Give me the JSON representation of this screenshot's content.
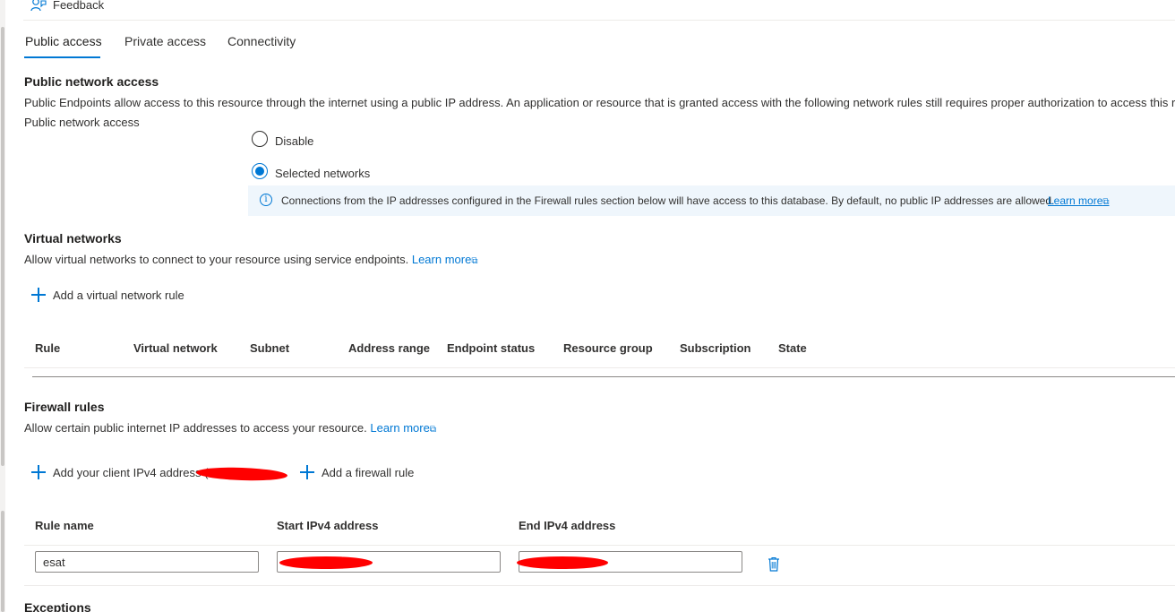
{
  "header": {
    "feedback_label": "Feedback"
  },
  "tabs": [
    {
      "label": "Public access",
      "active": true
    },
    {
      "label": "Private access",
      "active": false
    },
    {
      "label": "Connectivity",
      "active": false
    }
  ],
  "public_network_access": {
    "title": "Public network access",
    "description": "Public Endpoints allow access to this resource through the internet using a public IP address. An application or resource that is granted access with the following network rules still requires proper authorization to access this re",
    "field_label": "Public network access",
    "options": [
      {
        "label": "Disable",
        "selected": false
      },
      {
        "label": "Selected networks",
        "selected": true
      }
    ],
    "info_text": "Connections from the IP addresses configured in the Firewall rules section below will have access to this database. By default, no public IP addresses are allowed.",
    "info_link": "Learn more"
  },
  "virtual_networks": {
    "title": "Virtual networks",
    "description": "Allow virtual networks to connect to your resource using service endpoints.",
    "link": "Learn more",
    "add_rule_label": "Add a virtual network rule",
    "columns": [
      "Rule",
      "Virtual network",
      "Subnet",
      "Address range",
      "Endpoint status",
      "Resource group",
      "Subscription",
      "State"
    ]
  },
  "firewall_rules": {
    "title": "Firewall rules",
    "description": "Allow certain public internet IP addresses to access your resource.",
    "link": "Learn more",
    "add_client_label": "Add your client IPv4 address (",
    "add_rule_label": "Add a firewall rule",
    "columns": [
      "Rule name",
      "Start IPv4 address",
      "End IPv4 address"
    ],
    "rows": [
      {
        "rule_name": "esat",
        "start_ip": "",
        "end_ip": ""
      }
    ]
  },
  "exceptions": {
    "title": "Exceptions"
  },
  "colors": {
    "accent": "#0078d4",
    "redaction": "#ff0000",
    "info_bg": "#eff6fc"
  },
  "icons": [
    "feedback-icon",
    "info-icon",
    "plus-icon",
    "external-link-icon",
    "trash-icon"
  ]
}
